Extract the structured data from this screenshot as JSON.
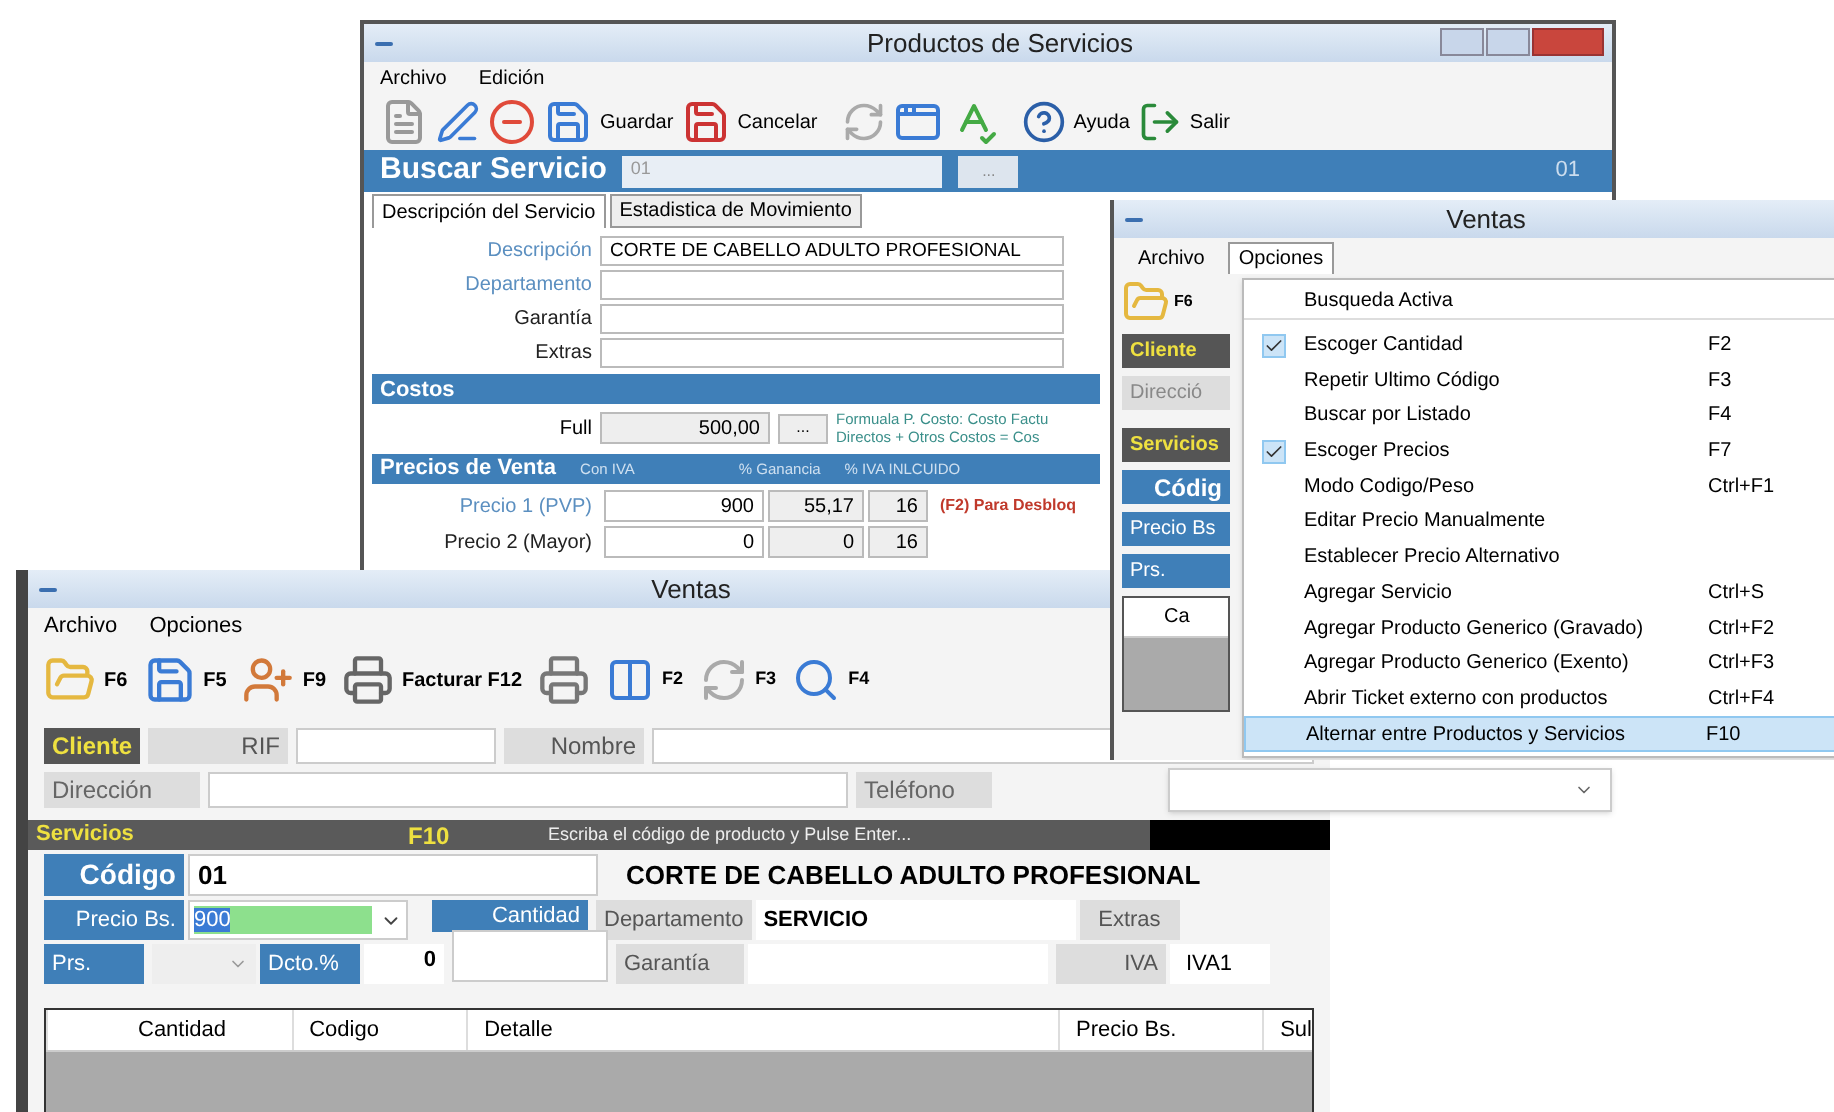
{
  "productos_window": {
    "title": "Productos de Servicios",
    "menu": [
      "Archivo",
      "Edición"
    ],
    "toolbar": [
      "Guardar",
      "Cancelar",
      "Ayuda",
      "Salir"
    ],
    "search": {
      "label": "Buscar Servicio",
      "value": "01",
      "button": "...",
      "code": "01"
    },
    "tabs": [
      {
        "label": "Descripción del Servicio",
        "selected": true
      },
      {
        "label": "Estadistica de Movimiento",
        "selected": false
      }
    ],
    "fields": [
      {
        "label": "Descripción",
        "value": "CORTE DE CABELLO ADULTO PROFESIONAL",
        "kind": "lookup"
      },
      {
        "label": "Departamento",
        "kind": "lookup"
      },
      {
        "label": "Garantía",
        "kind": "plain"
      },
      {
        "label": "Extras",
        "kind": "plain"
      }
    ],
    "costs": {
      "title": "Costos",
      "label": "Full",
      "value": "500,00",
      "button": "...",
      "formula": [
        "Formuala P. Costo: Costo Factu",
        "Directos + Otros Costos =  Cos"
      ]
    },
    "prices": {
      "title": "Precios de Venta",
      "columns": [
        "Con IVA",
        "% Ganancia",
        "% IVA INLCUIDO"
      ],
      "rows": [
        {
          "label": "Precio 1 (PVP)",
          "kind": "lookup",
          "values": [
            "900",
            "55,17",
            "16"
          ],
          "note": "(F2) Para Desbloq"
        },
        {
          "label": "Precio 2 (Mayor)",
          "kind": "plain",
          "values": [
            "0",
            "0",
            "16"
          ]
        }
      ]
    }
  },
  "ventas_menu_window": {
    "title": "Ventas",
    "menu": [
      {
        "label": "Archivo",
        "selected": false
      },
      {
        "label": "Opciones",
        "selected": true
      }
    ],
    "toolbar_key": "F6",
    "client_label": "Cliente",
    "address_label": "Direcció",
    "section_label": "Servicios",
    "code_label": "Códig",
    "price_label": "Precio Bs",
    "prs_label": "Prs.",
    "table_column": "Ca",
    "dropdown": [
      {
        "label": "Busqueda Activa",
        "checked": false,
        "selected": false
      },
      {
        "label": "Escoger Cantidad",
        "shortcut": "F2",
        "checked": true,
        "selected": false
      },
      {
        "label": "Repetir Ultimo Código",
        "shortcut": "F3",
        "checked": false,
        "selected": false
      },
      {
        "label": "Buscar por Listado",
        "shortcut": "F4",
        "checked": false,
        "selected": false
      },
      {
        "label": "Escoger Precios",
        "shortcut": "F7",
        "checked": true,
        "selected": false
      },
      {
        "label": "Modo Codigo/Peso",
        "shortcut": "Ctrl+F1",
        "checked": false,
        "selected": false
      },
      {
        "label": "Editar Precio Manualmente",
        "checked": false,
        "selected": false
      },
      {
        "label": "Establecer Precio Alternativo",
        "checked": false,
        "selected": false
      },
      {
        "label": "Agregar Servicio",
        "shortcut": "Ctrl+S",
        "checked": false,
        "selected": false
      },
      {
        "label": "Agregar Producto Generico (Gravado)",
        "shortcut": "Ctrl+F2",
        "checked": false,
        "selected": false
      },
      {
        "label": "Agregar Producto Generico (Exento)",
        "shortcut": "Ctrl+F3",
        "checked": false,
        "selected": false
      },
      {
        "label": "Abrir Ticket externo con productos",
        "shortcut": "Ctrl+F4",
        "checked": false,
        "selected": false
      },
      {
        "label": "Alternar entre  Productos y Servicios",
        "shortcut": "F10",
        "checked": false,
        "selected": true
      }
    ]
  },
  "ventas_window": {
    "title": "Ventas",
    "menu": [
      "Archivo",
      "Opciones"
    ],
    "toolbar": [
      "F6",
      "F5",
      "F9",
      "Facturar F12",
      "F2",
      "F3",
      "F4"
    ],
    "client_label": "Cliente",
    "rif_label": "RIF",
    "name_label": "Nombre",
    "address_label": "Dirección",
    "phone_label": "Teléfono",
    "section": {
      "label": "Servicios",
      "key": "F10",
      "hint": "Escriba el código de producto y Pulse Enter..."
    },
    "code_label": "Código",
    "code": "01",
    "description": "CORTE DE CABELLO ADULTO PROFESIONAL",
    "price_label": "Precio Bs.",
    "price": "900",
    "quantity_label": "Cantidad",
    "department_label": "Departamento",
    "department": "SERVICIO",
    "extras_label": "Extras",
    "prs_label": "Prs.",
    "discount_label": "Dcto.%",
    "discount": "0",
    "warranty_label": "Garantía",
    "tax_label": "IVA",
    "tax": "IVA1",
    "table": {
      "columns": [
        "Cantidad",
        "Codigo",
        "Detalle",
        "Precio Bs.",
        "Sul"
      ]
    }
  }
}
